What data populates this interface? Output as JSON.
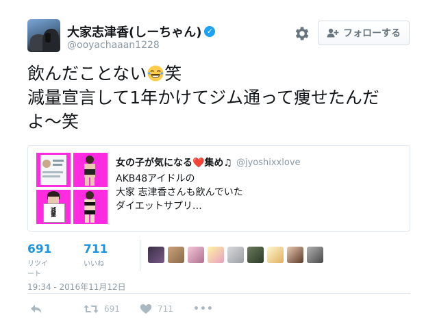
{
  "user": {
    "display_name": "大家志津香(しーちゃん)",
    "verified_mark": "✓",
    "handle": "@ooyachaaan1228"
  },
  "follow_button": {
    "label": "フォローする",
    "icon": "add-user-icon"
  },
  "settings": {
    "icon": "gear-icon"
  },
  "tweet": {
    "line1_pre": "飲んだことない",
    "line1_emoji": "face-with-tears-of-joy",
    "line1_post": "笑",
    "line2": "減量宣言して1年かけてジム通って痩せたんだ",
    "line3": "よ〜笑"
  },
  "card": {
    "title": "女の子が気になる❤️集め♫",
    "handle": "@jyoshixxlove",
    "lines": [
      "AKB48アイドルの",
      "大家 志津香さんも飲んでいた",
      "ダイエットサプリ…"
    ]
  },
  "stats": {
    "retweets": {
      "count": "691",
      "label": "リツイート"
    },
    "likes": {
      "count": "711",
      "label": "いいね"
    }
  },
  "likers_count": 9,
  "timestamp": "19:34 - 2016年11月12日",
  "actions": {
    "reply": {
      "icon": "reply-icon"
    },
    "retweet": {
      "icon": "retweet-icon",
      "count": "691"
    },
    "like": {
      "icon": "heart-icon",
      "count": "711"
    },
    "more": {
      "icon": "more-icon",
      "label": "•••"
    }
  },
  "colors": {
    "accent": "#1b95e0",
    "verified": "#1da1f2",
    "muted": "#8899a6",
    "card_thumb_bg": "#ff2be0"
  }
}
